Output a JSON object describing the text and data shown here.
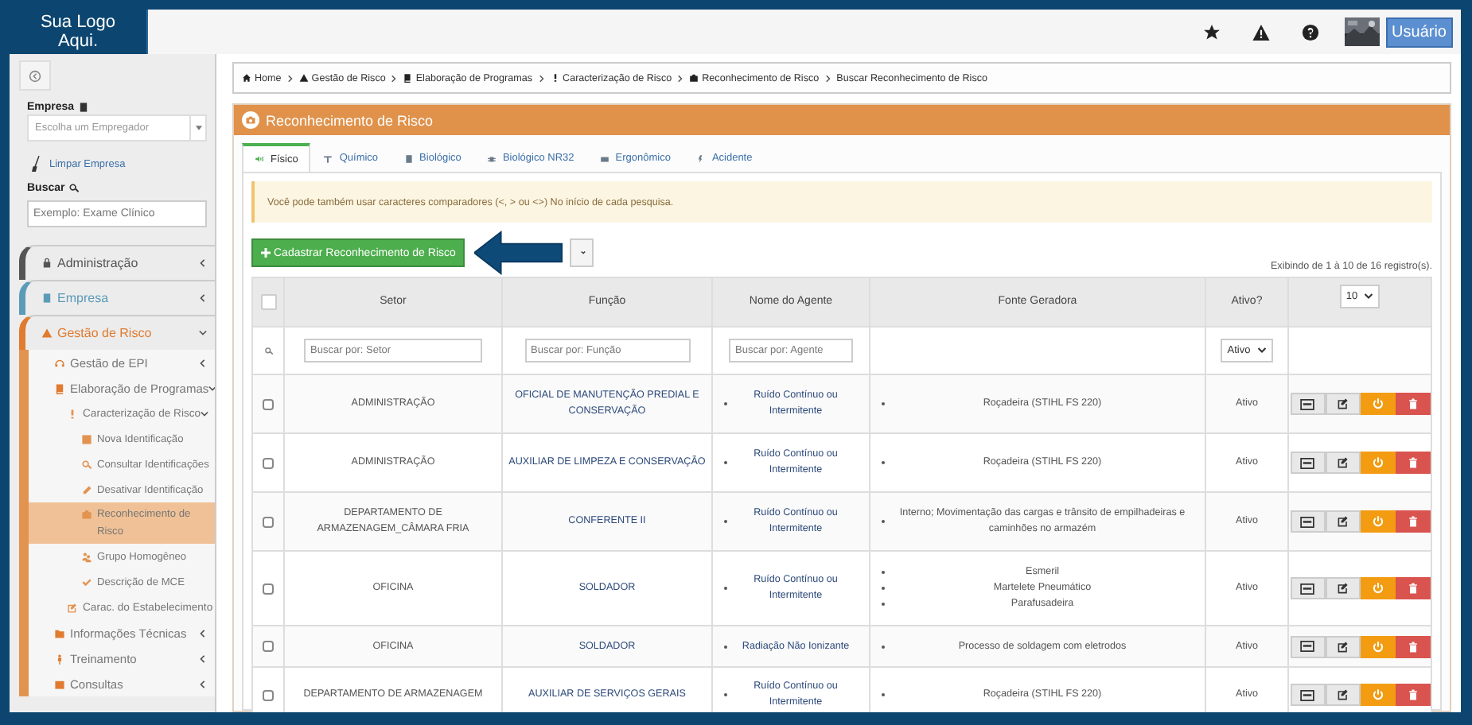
{
  "header": {
    "logo": "Sua Logo Aqui.",
    "user_button": "Usuário"
  },
  "sidebar": {
    "company_label": "Empresa",
    "company_select": {
      "placeholder": "Escolha um Empregador"
    },
    "clear_link": "Limpar Empresa",
    "search_label": "Buscar",
    "search": {
      "placeholder": "Exemplo: Exame Clínico"
    },
    "menu": [
      {
        "label": "Administração",
        "color": "#555555",
        "expanded": false,
        "selected": false
      },
      {
        "label": "Empresa",
        "color": "#5b9bb8",
        "expanded": false,
        "selected": false
      },
      {
        "label": "Gestão de Risco",
        "color": "#e07b2f",
        "expanded": true,
        "selected": false,
        "children": [
          {
            "label": "Gestão de EPI",
            "expanded": false,
            "selected": false
          },
          {
            "label": "Elaboração de Programas",
            "expanded": true,
            "selected": false,
            "children": [
              {
                "label": "Caracterização de Risco",
                "expanded": true,
                "selected": false,
                "children": [
                  {
                    "label": "Nova Identificação",
                    "selected": false
                  },
                  {
                    "label": "Consultar Identificações",
                    "selected": false
                  },
                  {
                    "label": "Desativar Identificação",
                    "selected": false
                  },
                  {
                    "label": "Reconhecimento de Risco",
                    "selected": true
                  },
                  {
                    "label": "Grupo Homogêneo",
                    "selected": false
                  },
                  {
                    "label": "Descrição de MCE",
                    "selected": false
                  }
                ]
              },
              {
                "label": "Carac. do Estabelecimento",
                "selected": false
              }
            ]
          },
          {
            "label": "Informações Técnicas",
            "expanded": false,
            "selected": false
          },
          {
            "label": "Treinamento",
            "expanded": false,
            "selected": false
          },
          {
            "label": "Consultas",
            "expanded": false,
            "selected": false
          }
        ]
      }
    ]
  },
  "breadcrumb": [
    "Home",
    "Gestão de Risco",
    "Elaboração de Programas",
    "Caracterização de Risco",
    "Reconhecimento de Risco",
    "Buscar Reconhecimento de Risco"
  ],
  "panel_title": "Reconhecimento de Risco",
  "tabs": [
    {
      "label": "Físico",
      "selected": true
    },
    {
      "label": "Químico",
      "selected": false
    },
    {
      "label": "Biológico",
      "selected": false
    },
    {
      "label": "Biológico NR32",
      "selected": false
    },
    {
      "label": "Ergonômico",
      "selected": false
    },
    {
      "label": "Acidente",
      "selected": false
    }
  ],
  "alert": "Você pode também usar caracteres comparadores (<, > ou <>) No início de cada pesquisa.",
  "add_button": "Cadastrar Reconhecimento de Risco",
  "record_info": "Exibindo de 1 à 10 de 16 registro(s).",
  "page_size": "10",
  "table": {
    "columns": [
      "Setor",
      "Função",
      "Nome do Agente",
      "Fonte Geradora",
      "Ativo?"
    ],
    "filter_placeholders": [
      "Buscar por: Setor",
      "Buscar por: Função",
      "Buscar por: Agente"
    ],
    "active_filter": "Ativo",
    "all_selected": false,
    "rows": [
      {
        "selected": false,
        "setor": "ADMINISTRAÇÃO",
        "funcao": "OFICIAL DE MANUTENÇÃO PREDIAL E CONSERVAÇÃO",
        "agentes": [
          "Ruído Contínuo ou Intermitente"
        ],
        "fontes": [
          "Roçadeira (STIHL FS 220)"
        ],
        "ativo": "Ativo"
      },
      {
        "selected": false,
        "setor": "ADMINISTRAÇÃO",
        "funcao": "AUXILIAR DE LIMPEZA E CONSERVAÇÃO",
        "agentes": [
          "Ruído Contínuo ou Intermitente"
        ],
        "fontes": [
          "Roçadeira (STIHL FS 220)"
        ],
        "ativo": "Ativo"
      },
      {
        "selected": false,
        "setor": "DEPARTAMENTO DE ARMAZENAGEM_CÂMARA FRIA",
        "funcao": "CONFERENTE II",
        "agentes": [
          "Ruído Contínuo ou Intermitente"
        ],
        "fontes": [
          "Interno; Movimentação das cargas e trânsito de empilhadeiras e caminhões no armazém"
        ],
        "ativo": "Ativo"
      },
      {
        "selected": false,
        "setor": "OFICINA",
        "funcao": "SOLDADOR",
        "agentes": [
          "Ruído Contínuo ou Intermitente"
        ],
        "fontes": [
          "Esmeril",
          "Martelete Pneumático",
          "Parafusadeira"
        ],
        "ativo": "Ativo"
      },
      {
        "selected": false,
        "setor": "OFICINA",
        "funcao": "SOLDADOR",
        "agentes": [
          "Radiação Não Ionizante"
        ],
        "fontes": [
          "Processo de soldagem com eletrodos"
        ],
        "ativo": "Ativo"
      },
      {
        "selected": false,
        "setor": "DEPARTAMENTO DE ARMAZENAGEM",
        "funcao": "AUXILIAR DE SERVIÇOS GERAIS",
        "agentes": [
          "Ruído Contínuo ou Intermitente"
        ],
        "fontes": [
          "Roçadeira (STIHL FS 220)"
        ],
        "ativo": "Ativo"
      }
    ]
  }
}
